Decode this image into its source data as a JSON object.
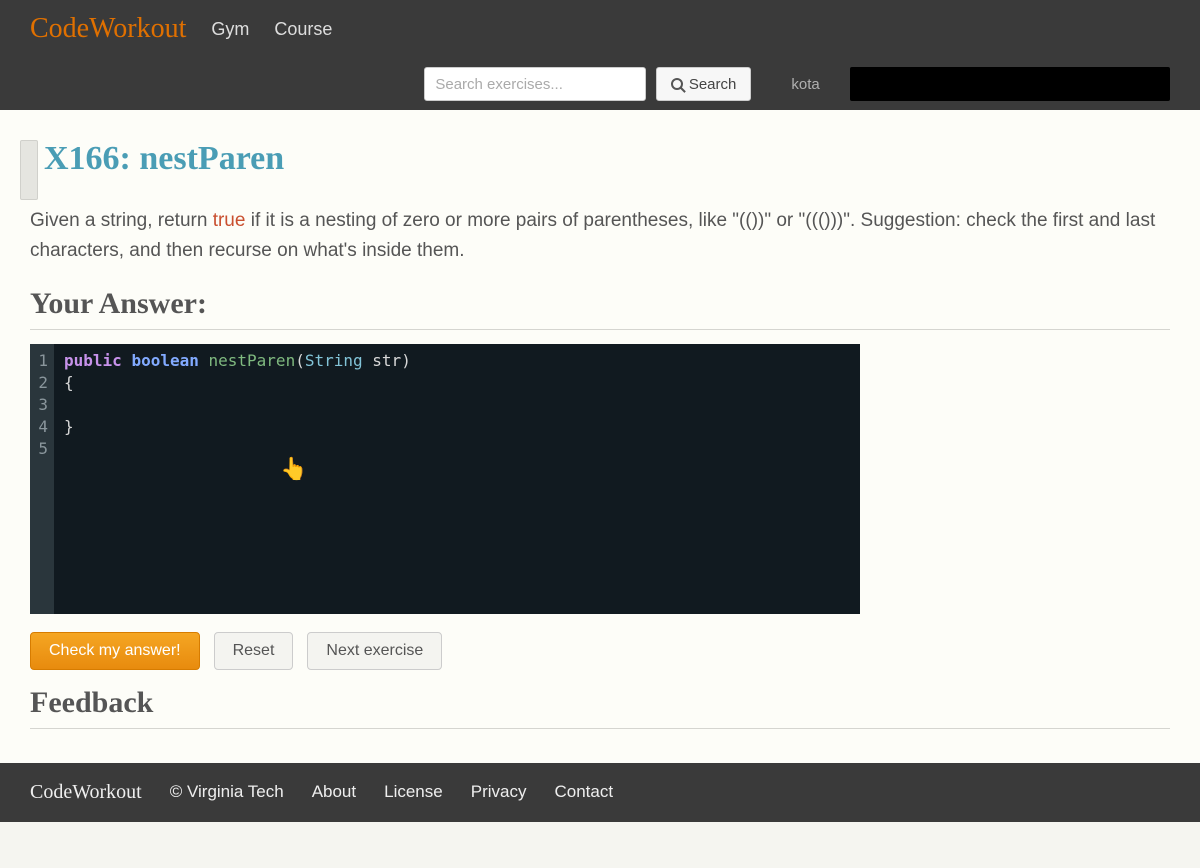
{
  "nav": {
    "brand": "CodeWorkout",
    "links": [
      "Gym",
      "Course"
    ]
  },
  "search": {
    "placeholder": "Search exercises...",
    "button": "Search",
    "user_hint": "kota"
  },
  "exercise": {
    "title": "X166: nestParen",
    "prompt_before": "Given a string, return ",
    "prompt_kw": "true",
    "prompt_after": " if it is a nesting of zero or more pairs of parentheses, like \"(())\" or \"((()))\". Suggestion: check the first and last characters, and then recurse on what's inside them."
  },
  "answer_heading": "Your Answer:",
  "editor": {
    "line_numbers": [
      "1",
      "2",
      "3",
      "4",
      "5"
    ],
    "tokens": [
      [
        {
          "t": "public ",
          "c": "tok-kw"
        },
        {
          "t": "boolean ",
          "c": "tok-type"
        },
        {
          "t": "nestParen",
          "c": "tok-fn"
        },
        {
          "t": "(",
          "c": "tok-brace"
        },
        {
          "t": "String ",
          "c": "tok-cls"
        },
        {
          "t": "str",
          "c": "tok-param"
        },
        {
          "t": ")",
          "c": "tok-brace"
        }
      ],
      [
        {
          "t": "{",
          "c": "tok-brace"
        }
      ],
      [],
      [
        {
          "t": "}",
          "c": "tok-brace"
        }
      ],
      []
    ]
  },
  "buttons": {
    "check": "Check my answer!",
    "reset": "Reset",
    "next": "Next exercise"
  },
  "feedback_heading": "Feedback",
  "footer": {
    "brand": "CodeWorkout",
    "copyright": "© Virginia Tech",
    "links": [
      "About",
      "License",
      "Privacy",
      "Contact"
    ]
  }
}
